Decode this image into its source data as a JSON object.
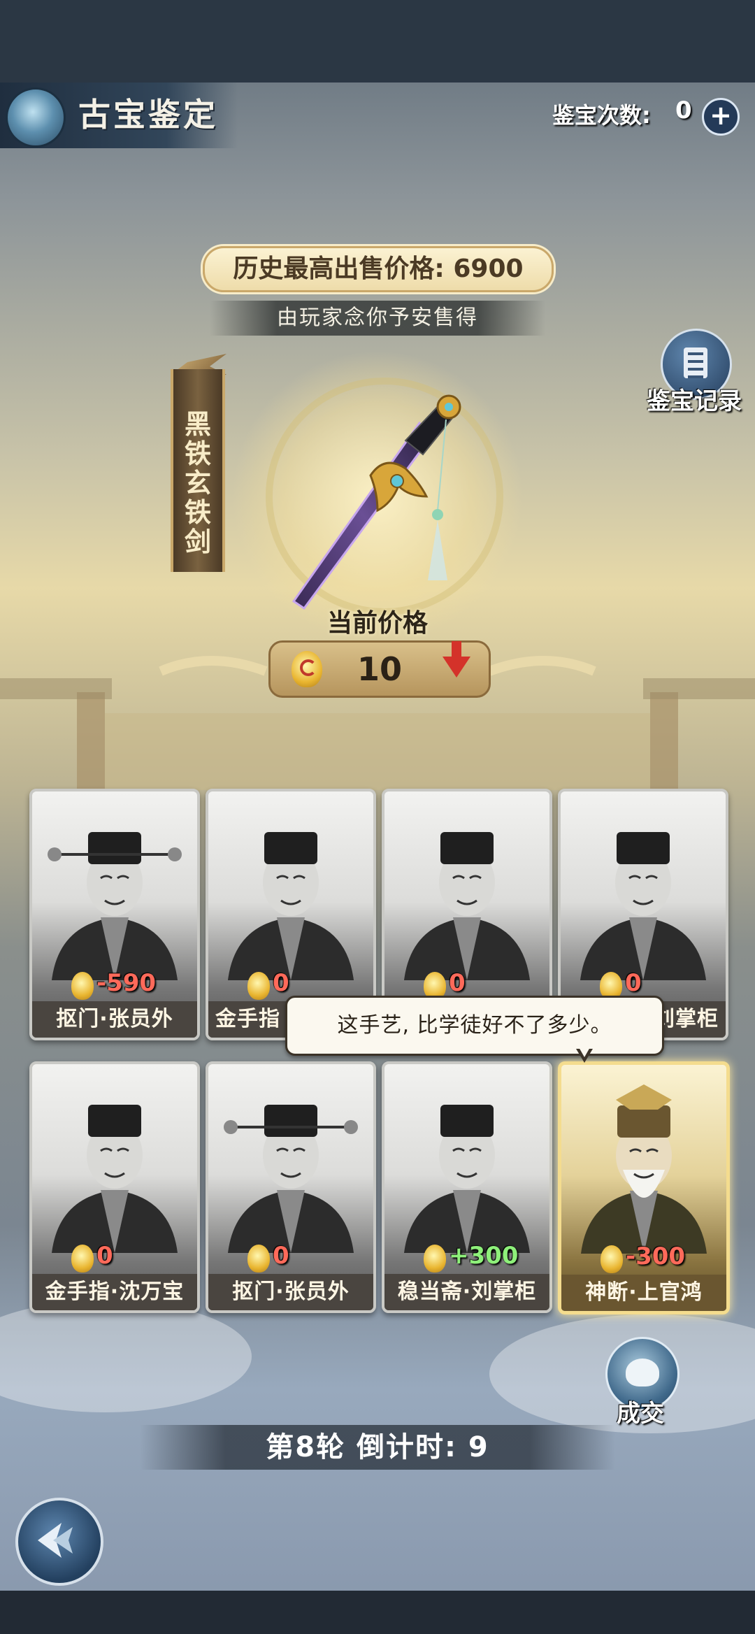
{
  "header": {
    "title": "古宝鉴定",
    "count_label": "鉴宝次数:",
    "count_value": "0",
    "plus_label": "+"
  },
  "history": {
    "banner": "历史最高出售价格: 6900",
    "seller": "由玩家念你予安售得"
  },
  "record_button": {
    "label": "鉴宝记录"
  },
  "item": {
    "name": "黑铁玄铁剑",
    "current_price_label": "当前价格",
    "current_price": "10",
    "trend": "down"
  },
  "cards": [
    {
      "name": "抠门·张员外",
      "value": "-590",
      "type": "neg",
      "portrait": "official-hat"
    },
    {
      "name": "金手指·沈万宝",
      "value": "0",
      "type": "zero",
      "portrait": "merchant"
    },
    {
      "name": "稳当斋·刘掌柜",
      "value": "0",
      "type": "zero",
      "portrait": "scholar"
    },
    {
      "name": "稳当斋·刘掌柜",
      "value": "0",
      "type": "zero",
      "portrait": "scholar"
    },
    {
      "name": "金手指·沈万宝",
      "value": "0",
      "type": "zero",
      "portrait": "merchant"
    },
    {
      "name": "抠门·张员外",
      "value": "0",
      "type": "zero",
      "portrait": "official-hat"
    },
    {
      "name": "稳当斋·刘掌柜",
      "value": "+300",
      "type": "pos",
      "portrait": "scholar"
    },
    {
      "name": "神断·上官鸿",
      "value": "-300",
      "type": "neg",
      "portrait": "elder",
      "active": true
    }
  ],
  "card_names_visible": {
    "c2": "金手指",
    "c4": "刘掌柜"
  },
  "bubble": {
    "text": "这手艺, 比学徒好不了多少。"
  },
  "deal_button": {
    "label": "成交"
  },
  "round": {
    "text": "第8轮  倒计时:  9"
  },
  "colors": {
    "accent_gold": "#eedcaa",
    "negative": "#ff6a5a",
    "positive": "#8ef07a",
    "header_dark": "#2b3744"
  }
}
